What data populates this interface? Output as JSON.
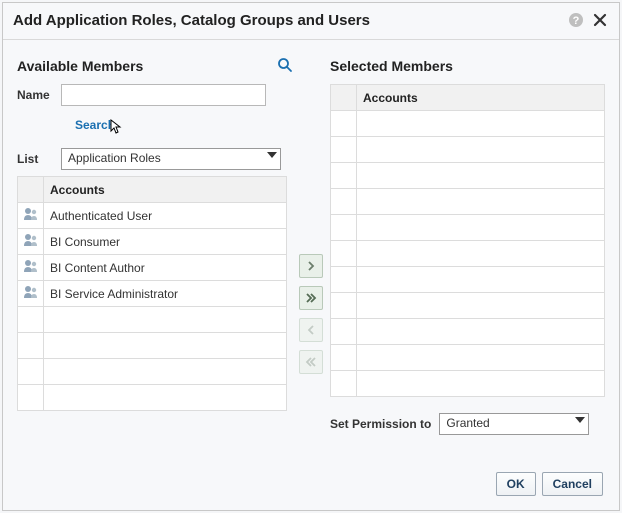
{
  "dialog": {
    "title": "Add Application Roles, Catalog Groups and Users"
  },
  "left": {
    "heading": "Available Members",
    "name_label": "Name",
    "name_value": "",
    "search_label": "Search",
    "list_label": "List",
    "list_value": "Application Roles",
    "grid_header": "Accounts",
    "rows": [
      "Authenticated User",
      "BI Consumer",
      "BI Content Author",
      "BI Service Administrator"
    ]
  },
  "right": {
    "heading": "Selected Members",
    "grid_header": "Accounts",
    "perm_label": "Set Permission to",
    "perm_value": "Granted"
  },
  "footer": {
    "ok": "OK",
    "cancel": "Cancel"
  }
}
